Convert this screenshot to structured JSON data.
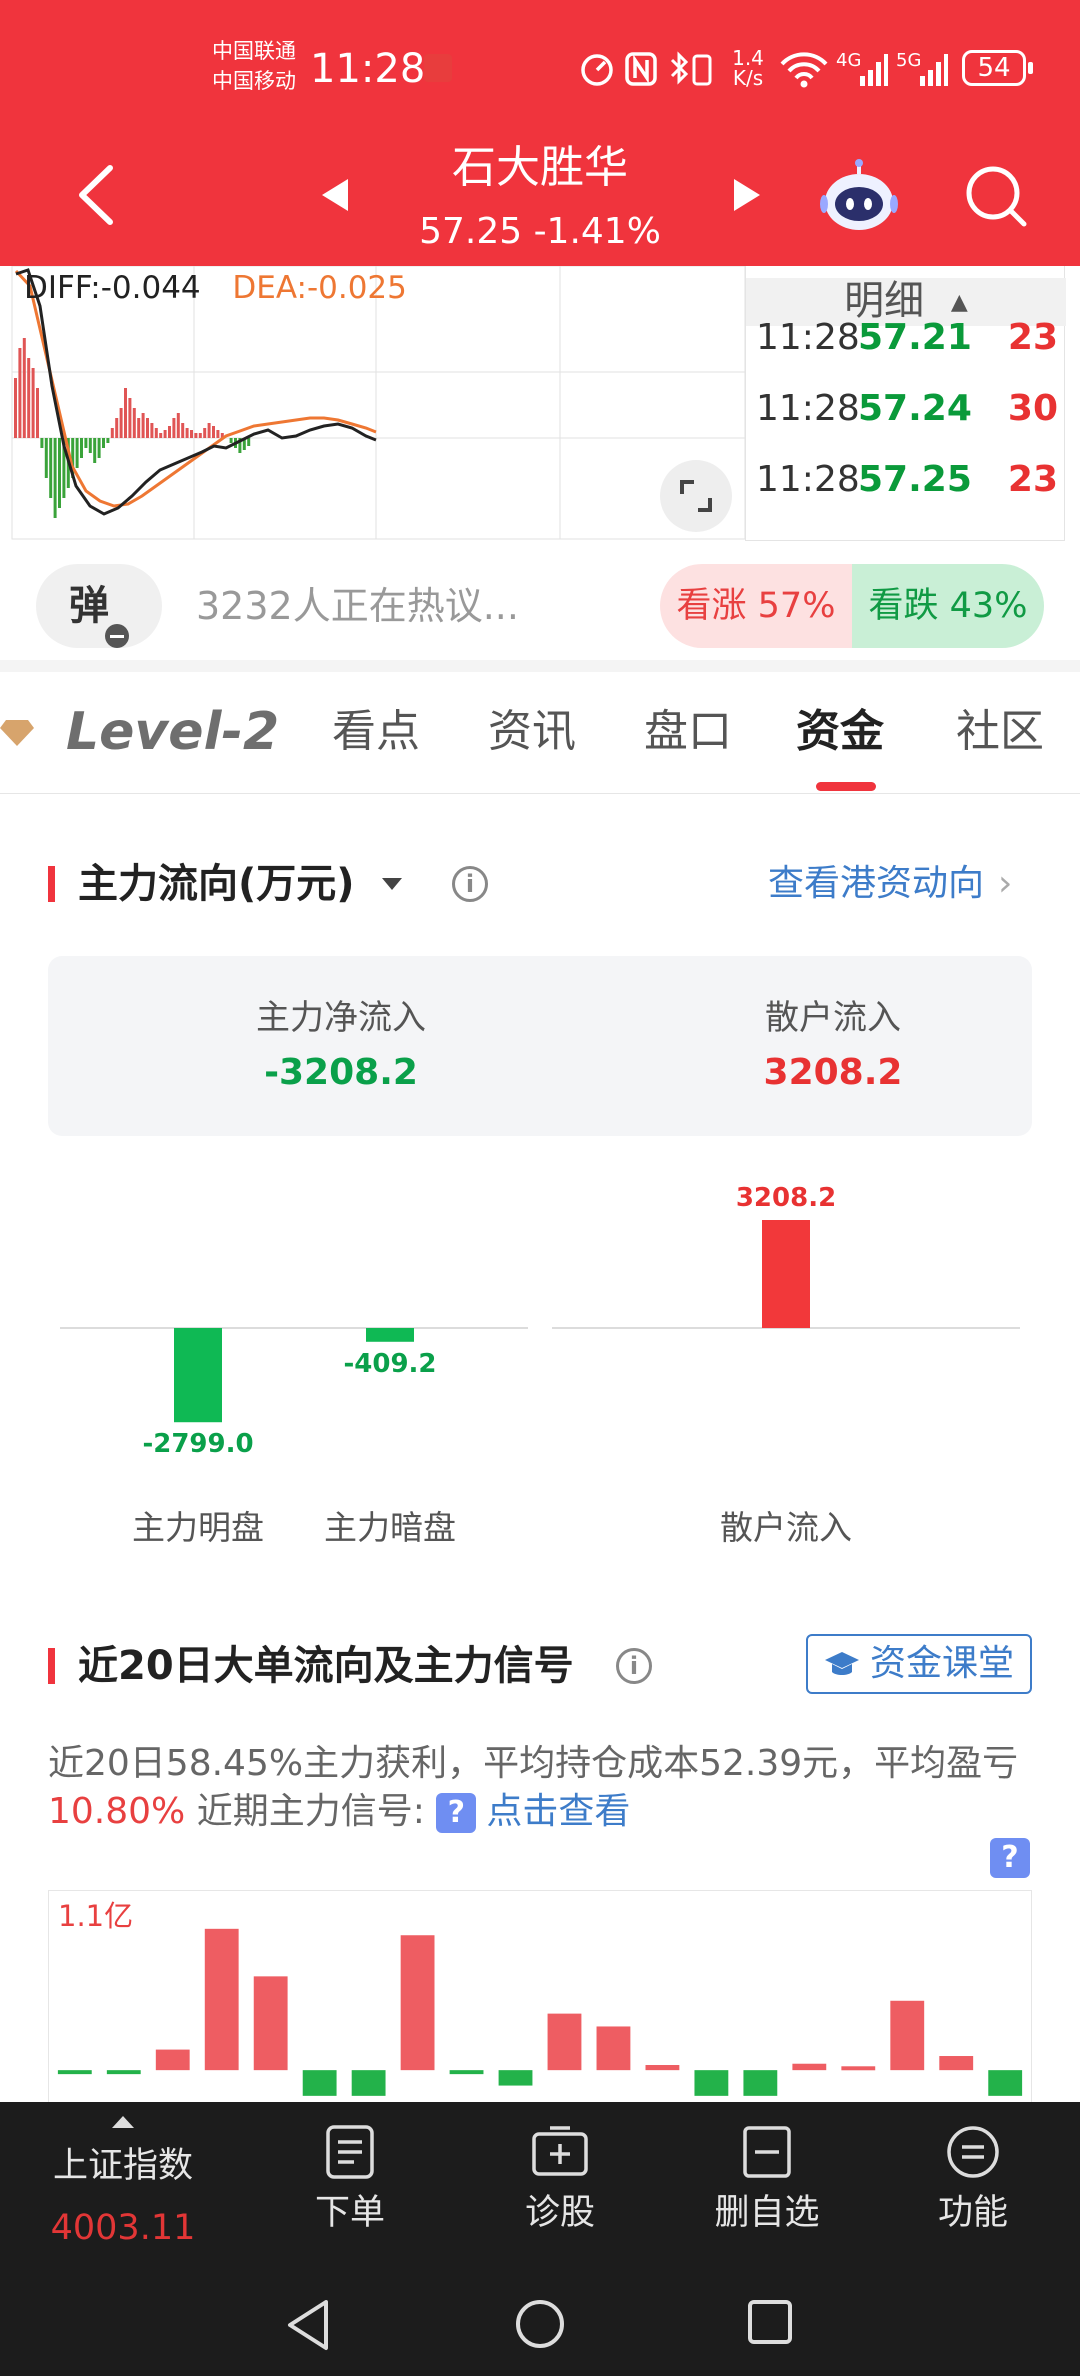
{
  "status_bar": {
    "carrier1": "中国联通",
    "carrier2": "中国移动",
    "time": "11:28",
    "net_speed_value": "1.4",
    "net_speed_unit": "K/s",
    "signal1": "4G",
    "signal2": "5G",
    "battery": "54"
  },
  "header": {
    "title": "石大胜华",
    "subtitle": "57.25  -1.41%"
  },
  "kline": {
    "diff_label": "DIFF:-0.044",
    "dea_label": "DEA:-0.025",
    "diff_color": "#222222",
    "dea_color": "#ee7733"
  },
  "ticks": {
    "header": "明细",
    "rows": [
      {
        "time": "11:28",
        "price": "57.21",
        "vol": "23"
      },
      {
        "time": "11:28",
        "price": "57.24",
        "vol": "30"
      },
      {
        "time": "11:28",
        "price": "57.25",
        "vol": "23"
      }
    ]
  },
  "discuss": {
    "danmu_label": "弹",
    "hot_text": "3232人正在热议...",
    "bull": "看涨 57%",
    "bear": "看跌 43%"
  },
  "tabs": {
    "items": [
      "Level-2",
      "看点",
      "资讯",
      "盘口",
      "资金",
      "社区"
    ],
    "active": "资金"
  },
  "fund_flow": {
    "title": "主力流向(万元)",
    "link": "查看港资动向",
    "main_net_label": "主力净流入",
    "main_net_value": "-3208.2",
    "retail_label": "散户流入",
    "retail_value": "3208.2",
    "chart_data": {
      "type": "bar",
      "categories": [
        "主力明盘",
        "主力暗盘",
        "散户流入"
      ],
      "values": [
        -2799.0,
        -409.2,
        3208.2
      ],
      "value_labels": [
        "-2799.0",
        "-409.2",
        "3208.2"
      ],
      "colors": {
        "positive": "#f2383a",
        "negative": "#0fb954"
      }
    }
  },
  "big_order": {
    "title": "近20日大单流向及主力信号",
    "class_button": "资金课堂",
    "desc_prefix": "近20日58.45%主力获利，平均持仓成本52.39元，平均盈亏",
    "desc_pct": "10.80%",
    "desc_mid": " 近期主力信号: ",
    "desc_link": "点击查看",
    "y_label": "1.1亿",
    "chart_data": {
      "type": "bar",
      "values": [
        -0.03,
        -0.03,
        0.16,
        1.1,
        0.73,
        -0.2,
        -0.2,
        1.05,
        -0.03,
        -0.12,
        0.44,
        0.34,
        0.04,
        -0.2,
        -0.2,
        0.05,
        0.03,
        0.54,
        0.11,
        -0.2
      ],
      "ylim": [
        -0.25,
        1.2
      ],
      "colors": {
        "positive": "#ee5d62",
        "negative": "#23b24a"
      }
    }
  },
  "bottom_bar": {
    "index_name": "上证指数",
    "index_value": "4003.11",
    "items": [
      "下单",
      "诊股",
      "删自选",
      "功能"
    ]
  }
}
